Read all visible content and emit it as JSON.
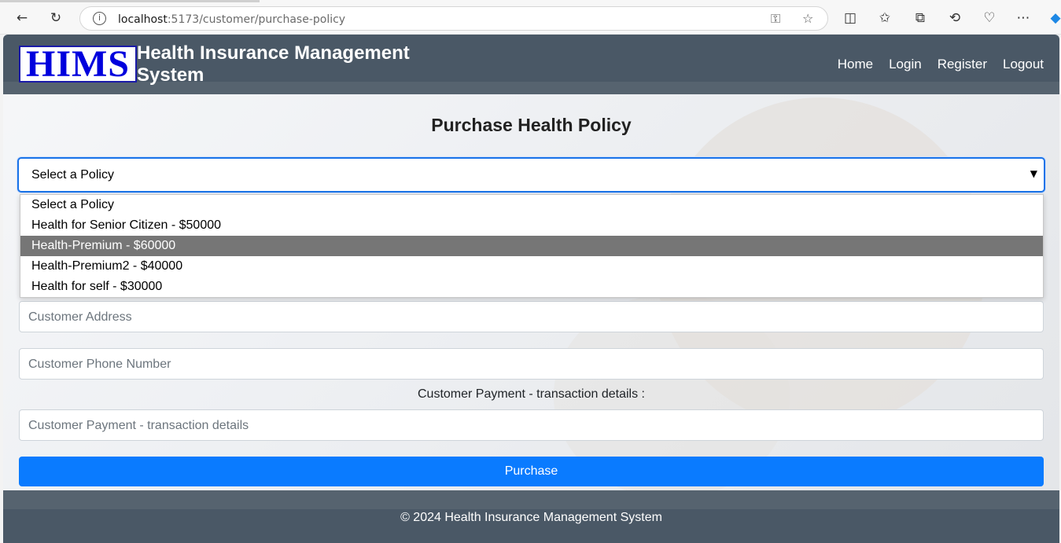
{
  "browser": {
    "url_host": "localhost",
    "url_path": ":5173/customer/purchase-policy"
  },
  "header": {
    "logo_text": "HIMS",
    "brand": "Health Insurance Management System",
    "nav": [
      "Home",
      "Login",
      "Register",
      "Logout"
    ]
  },
  "main": {
    "title": "Purchase Health Policy",
    "policy_select": {
      "value": "Select a Policy",
      "options": [
        "Select a Policy",
        "Health for Senior Citizen - $50000",
        "Health-Premium - $60000",
        "Health-Premium2 - $40000",
        "Health for self - $30000"
      ],
      "highlighted_index": 2
    },
    "address_placeholder": "Customer Address",
    "phone_placeholder": "Customer Phone Number",
    "payment_label": "Customer Payment - transaction details :",
    "payment_placeholder": "Customer Payment - transaction details",
    "purchase_label": "Purchase"
  },
  "footer": {
    "text": "© 2024 Health Insurance Management System"
  },
  "colors": {
    "nav_bg": "#4a5866",
    "primary": "#0a7bff",
    "highlight": "#767676"
  }
}
